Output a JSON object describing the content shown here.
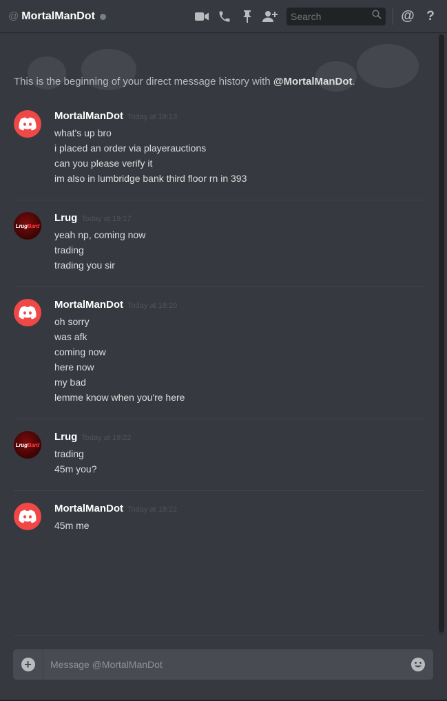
{
  "header": {
    "at_symbol": "@",
    "dm_name": "MortalManDot",
    "search_placeholder": "Search",
    "icons": [
      "video-call-icon",
      "voice-call-icon",
      "pin-icon",
      "add-friend-icon",
      "search-icon",
      "mentions-icon",
      "help-icon"
    ],
    "mention_glyph": "@",
    "help_glyph": "?"
  },
  "intro": {
    "text": "This is the beginning of your direct message history with ",
    "name": "@MortalManDot",
    "end": "."
  },
  "groups": [
    {
      "author": "MortalManDot",
      "timestamp": "Today at 19:13",
      "avatar": "discord-default",
      "lines": [
        "what's up bro",
        "i placed an order via playerauctions",
        "can you please verify it",
        "im also in lumbridge bank third floor rn in 393"
      ]
    },
    {
      "author": "Lrug",
      "timestamp": "Today at 19:17",
      "avatar": "lrug-logo",
      "lines": [
        "yeah np, coming now",
        "trading",
        "trading you sir"
      ]
    },
    {
      "author": "MortalManDot",
      "timestamp": "Today at 19:20",
      "avatar": "discord-default",
      "lines": [
        "oh sorry",
        "was afk",
        "coming now",
        "here now",
        "my bad",
        "lemme know when you're here"
      ]
    },
    {
      "author": "Lrug",
      "timestamp": "Today at 19:22",
      "avatar": "lrug-logo",
      "lines": [
        "trading",
        "45m you?"
      ]
    },
    {
      "author": "MortalManDot",
      "timestamp": "Today at 19:22",
      "avatar": "discord-default",
      "lines": [
        "45m me"
      ]
    }
  ],
  "avatar_logo": {
    "left": "Lrug",
    "right": "Bard"
  },
  "composer": {
    "placeholder": "Message @MortalManDot",
    "add_glyph": "+"
  },
  "colors": {
    "background": "#36393f",
    "discord_avatar": "#f04747",
    "composer": "#484c52",
    "timestamp": "#4f545c"
  }
}
